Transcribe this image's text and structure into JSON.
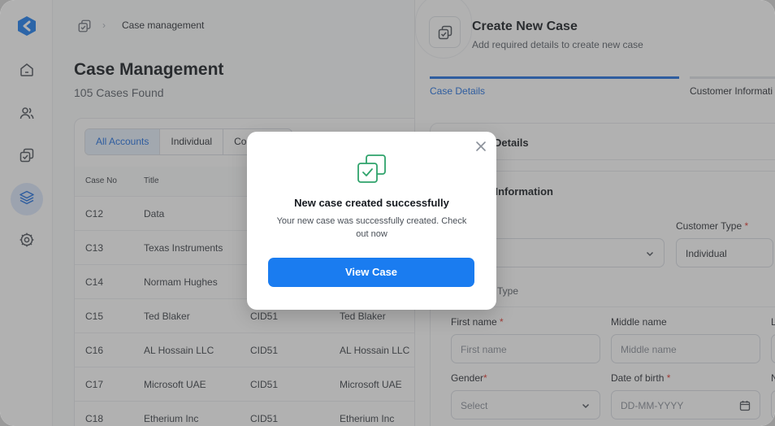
{
  "breadcrumb": {
    "current": "Case management"
  },
  "page": {
    "title": "Case Management",
    "count_text": "105 Cases Found"
  },
  "filters": {
    "tabs": [
      "All Accounts",
      "Individual",
      "Co"
    ]
  },
  "table": {
    "headers": {
      "case_no": "Case No",
      "title": "Title"
    },
    "rows": [
      {
        "case_no": "C12",
        "title": "Data",
        "cid": "",
        "name": ""
      },
      {
        "case_no": "C13",
        "title": "Texas Instruments",
        "cid": "",
        "name": ""
      },
      {
        "case_no": "C14",
        "title": "Normam Hughes",
        "cid": "",
        "name": ""
      },
      {
        "case_no": "C15",
        "title": "Ted Blaker",
        "cid": "CID51",
        "name": "Ted Blaker"
      },
      {
        "case_no": "C16",
        "title": "AL Hossain LLC",
        "cid": "CID51",
        "name": "AL Hossain LLC"
      },
      {
        "case_no": "C17",
        "title": "Microsoft UAE",
        "cid": "CID51",
        "name": "Microsoft UAE"
      },
      {
        "case_no": "C18",
        "title": "Etherium Inc",
        "cid": "CID51",
        "name": "Etherium Inc"
      }
    ]
  },
  "panel": {
    "title": "Create New Case",
    "subtitle": "Add required details to create new case",
    "tabs": {
      "active": "Case Details",
      "next": "Customer Informati"
    },
    "section1_title": "Details",
    "section2_title": "mer Information",
    "customer_type_label": "Customer Type",
    "customer_type_value": "Individual",
    "type_label": "Type",
    "first_name_label": "First name",
    "first_name_placeholder": "First name",
    "middle_name_label": "Middle name",
    "middle_name_placeholder": "Middle name",
    "last_name_label": "L",
    "gender_label": "Gender",
    "gender_placeholder": "Select",
    "dob_label": "Date of birth",
    "dob_placeholder": "DD-MM-YYYY",
    "n_label": "N"
  },
  "modal": {
    "title": "New case created successfully",
    "message": "Your new case was successfully created. Check out now",
    "button": "View Case"
  },
  "colors": {
    "accent": "#1a7cf0",
    "required": "#e0352b",
    "success": "#2fa36b"
  }
}
